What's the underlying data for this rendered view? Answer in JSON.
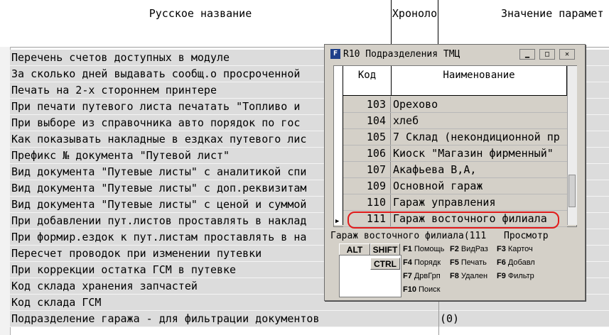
{
  "grid": {
    "headers": [
      "Русское название",
      "Хроноло",
      "Значение парамет"
    ],
    "rows": [
      {
        "name": "Перечень счетов доступных в модуле",
        "value": ""
      },
      {
        "name": "За сколько дней выдавать сообщ.о просроченной",
        "value": ""
      },
      {
        "name": "Печать на 2-х стороннем принтере",
        "value": ""
      },
      {
        "name": "При печати путевого листа печатать \"Топливо и",
        "value": ""
      },
      {
        "name": "При выборе из справочника авто порядок по гос",
        "value": ""
      },
      {
        "name": "Как показывать накладные в ездках путевого лис",
        "value": ""
      },
      {
        "name": "Префикс № документа \"Путевой лист\"",
        "value": ""
      },
      {
        "name": "Вид документа \"Путевые листы\" с аналитикой спи",
        "value": ""
      },
      {
        "name": "Вид документа \"Путевые листы\" с доп.реквизитам",
        "value": ""
      },
      {
        "name": "Вид документа \"Путевые листы\" с ценой и суммой",
        "value": ""
      },
      {
        "name": "При добавлении пут.листов проставлять в наклад",
        "value": ""
      },
      {
        "name": "При формир.ездок к пут.листам проставлять в на",
        "value": ""
      },
      {
        "name": "Пересчет проводок при изменении путевки",
        "value": ""
      },
      {
        "name": "При коррекции остатка ГСМ в путевке",
        "value": ""
      },
      {
        "name": "Код склада хранения запчастей",
        "value": ""
      },
      {
        "name": "Код склада ГСМ",
        "value": ""
      },
      {
        "name": "Подразделение гаража - для фильтрации документов",
        "value": "(0)"
      }
    ]
  },
  "dialog": {
    "title": "R10 Подразделения ТМЦ",
    "columns": {
      "code": "Код",
      "name": "Наименование"
    },
    "rows": [
      {
        "code": "103",
        "name": "Орехово"
      },
      {
        "code": "104",
        "name": "хлеб"
      },
      {
        "code": "105",
        "name": "7 Склад (некондиционной пр"
      },
      {
        "code": "106",
        "name": "Киоск \"Магазин фирменный\""
      },
      {
        "code": "107",
        "name": "Акафьева В,А,"
      },
      {
        "code": "109",
        "name": "Основной гараж"
      },
      {
        "code": "110",
        "name": "Гараж управления"
      },
      {
        "code": "111",
        "name": "Гараж восточного филиала"
      }
    ],
    "selected_index": 7,
    "status_left": "Гараж восточного филиала(111",
    "status_right": "Просмотр",
    "keys": {
      "alt": "ALT",
      "shift": "SHIFT",
      "ctrl": "CTRL"
    },
    "fkeys": [
      {
        "key": "F1",
        "label": "Помощь"
      },
      {
        "key": "F2",
        "label": "ВидРаз"
      },
      {
        "key": "F3",
        "label": "Карточ"
      },
      {
        "key": "F4",
        "label": "Порядк"
      },
      {
        "key": "F5",
        "label": "Печать"
      },
      {
        "key": "F6",
        "label": "Добавл"
      },
      {
        "key": "F7",
        "label": "ДрвГрп"
      },
      {
        "key": "F8",
        "label": "Удален"
      },
      {
        "key": "F9",
        "label": "Фильтр"
      },
      {
        "key": "F10",
        "label": "Поиск"
      }
    ]
  },
  "colors": {
    "highlight_oval": "#e21b1b",
    "row_bg": "#dcdcdc",
    "dialog_bg": "#d4d0c8"
  }
}
